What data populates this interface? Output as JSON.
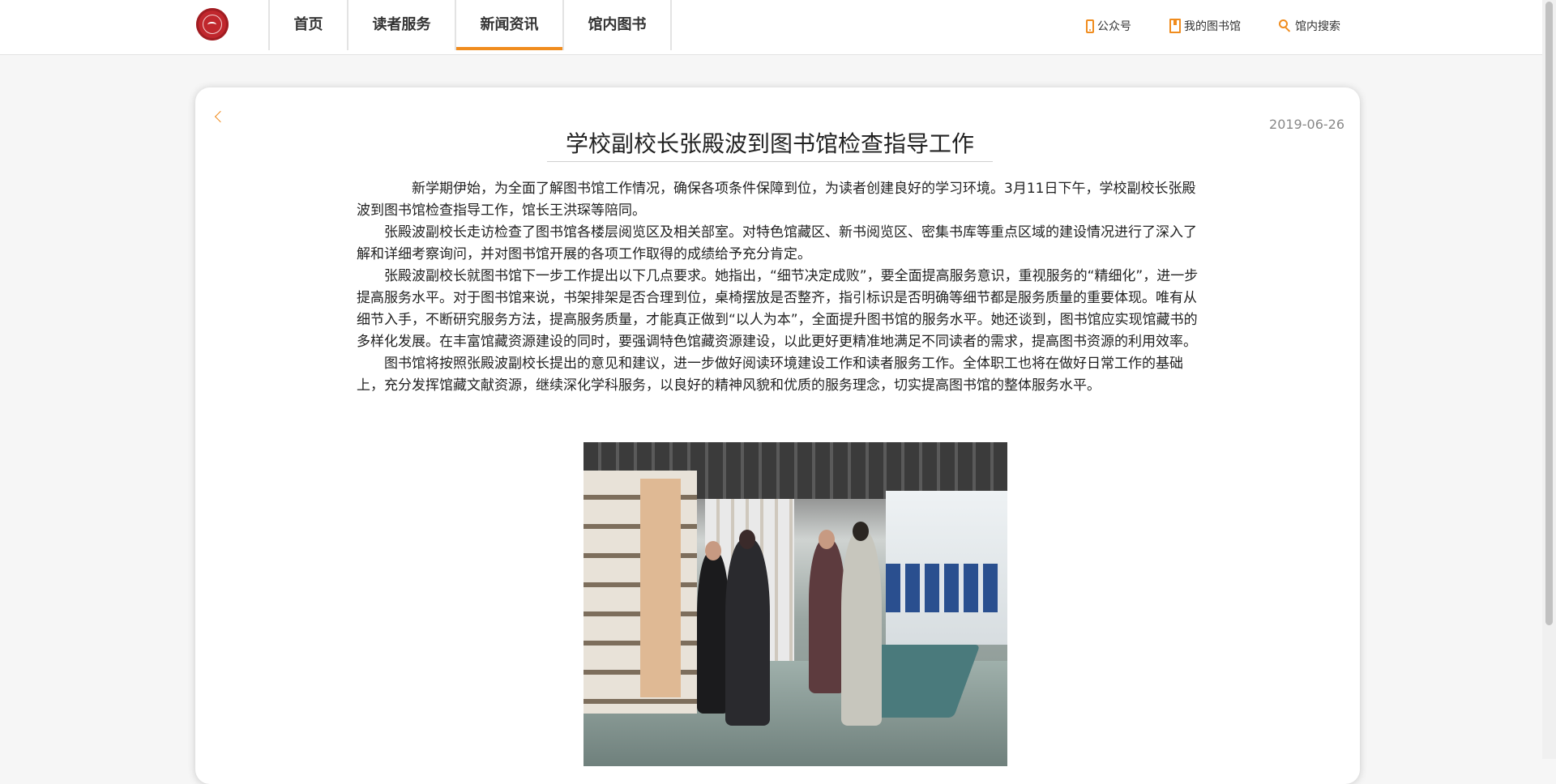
{
  "nav": {
    "items": [
      {
        "label": "首页"
      },
      {
        "label": "读者服务"
      },
      {
        "label": "新闻资讯"
      },
      {
        "label": "馆内图书"
      }
    ],
    "active_index": 2
  },
  "tools": {
    "official_account": "公众号",
    "my_library": "我的图书馆",
    "search": "馆内搜索"
  },
  "article": {
    "title": "学校副校长张殿波到图书馆检查指导工作",
    "date": "2019-06-26",
    "paragraphs": [
      "新学期伊始，为全面了解图书馆工作情况，确保各项条件保障到位，为读者创建良好的学习环境。3月11日下午，学校副校长张殿波到图书馆检查指导工作，馆长王洪琛等陪同。",
      "张殿波副校长走访检查了图书馆各楼层阅览区及相关部室。对特色馆藏区、新书阅览区、密集书库等重点区域的建设情况进行了深入了解和详细考察询问，并对图书馆开展的各项工作取得的成绩给予充分肯定。",
      "张殿波副校长就图书馆下一步工作提出以下几点要求。她指出，“细节决定成败”，要全面提高服务意识，重视服务的“精细化”，进一步提高服务水平。对于图书馆来说，书架排架是否合理到位，桌椅摆放是否整齐，指引标识是否明确等细节都是服务质量的重要体现。唯有从细节入手，不断研究服务方法，提高服务质量，才能真正做到“以人为本”，全面提升图书馆的服务水平。她还谈到，图书馆应实现馆藏书的多样化发展。在丰富馆藏资源建设的同时，要强调特色馆藏资源建设，以此更好更精准地满足不同读者的需求，提高图书资源的利用效率。",
      "图书馆将按照张殿波副校长提出的意见和建议，进一步做好阅读环境建设工作和读者服务工作。全体职工也将在做好日常工作的基础上，充分发挥馆藏文献资源，继续深化学科服务，以良好的精神风貌和优质的服务理念，切实提高图书馆的整体服务水平。"
    ]
  },
  "colors": {
    "accent": "#f08c1e",
    "logo": "#c0272d"
  },
  "icons": {
    "back": "chevron-left-icon",
    "official_account": "phone-icon",
    "my_library": "book-icon",
    "search": "search-icon"
  }
}
